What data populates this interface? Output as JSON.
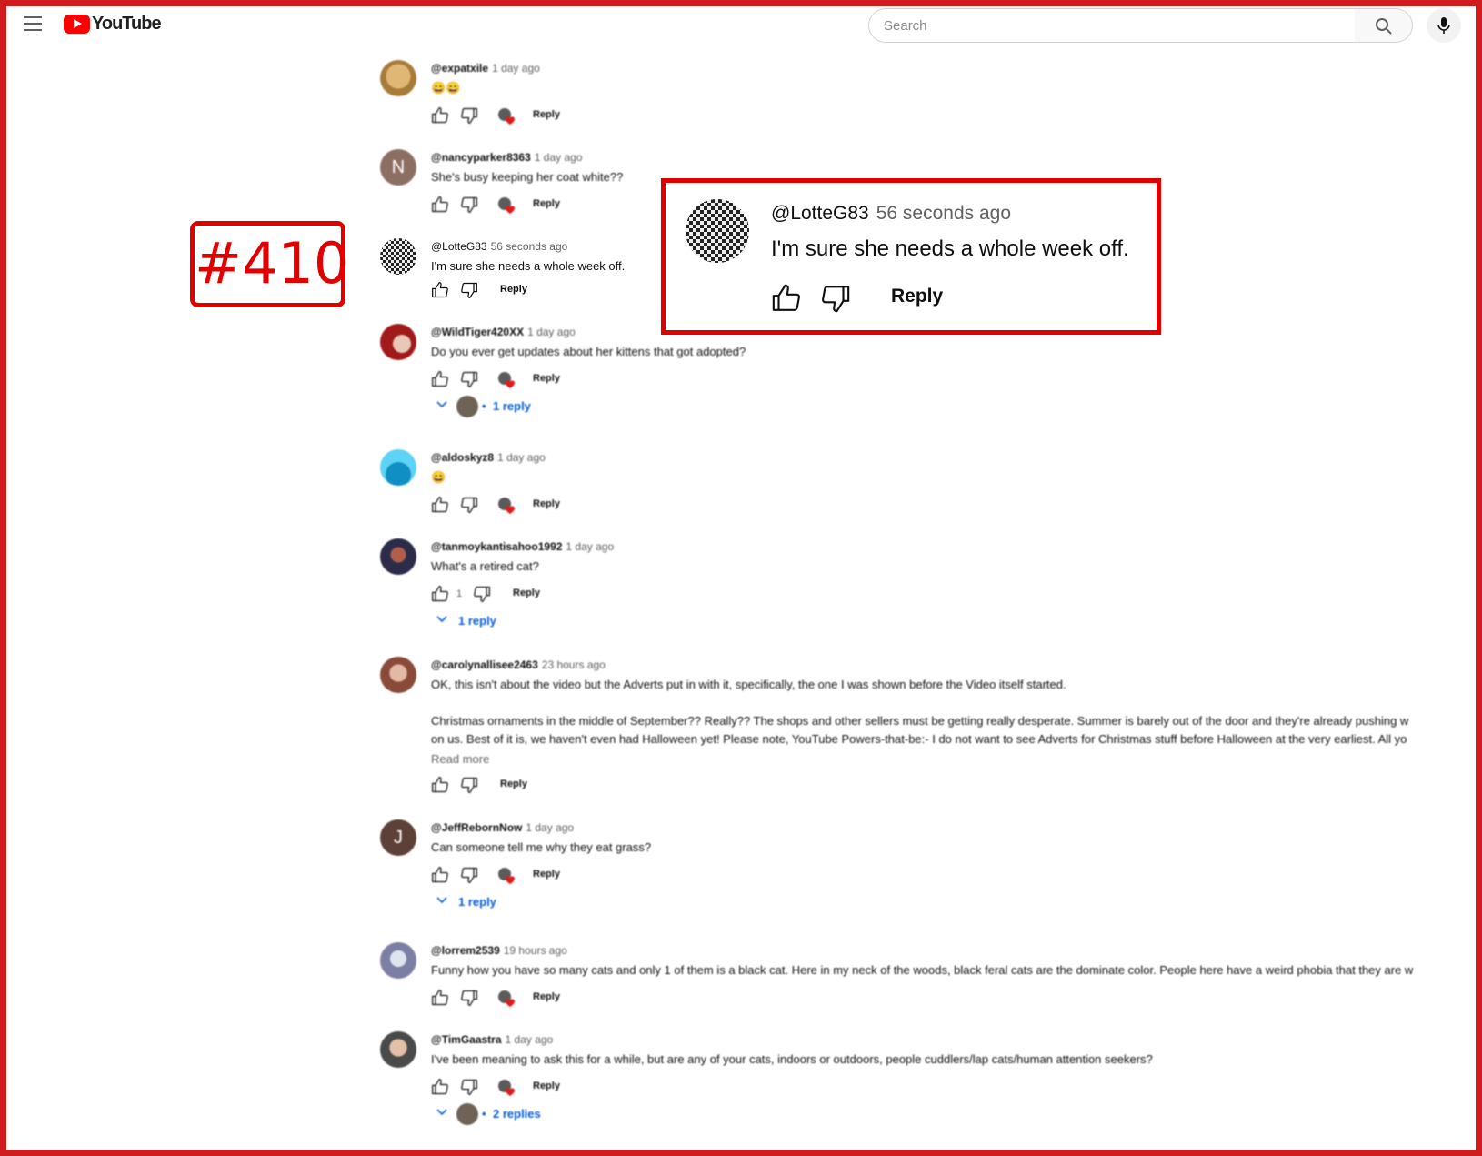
{
  "app": {
    "logo_text": "YouTube",
    "brand_color": "#ff0000",
    "search_placeholder": "Search"
  },
  "annotation": {
    "label": "#410",
    "color": "#e00000"
  },
  "callout": {
    "author": "@LotteG83",
    "time": "56 seconds ago",
    "text": "I'm sure she needs a whole week off.",
    "reply_label": "Reply"
  },
  "comments": [
    {
      "author": "@expatxile",
      "time": "1 day ago",
      "text": "😄😄",
      "reply_label": "Reply",
      "creator_heart": true
    },
    {
      "author": "@nancyparker8363",
      "time": "1 day ago",
      "text": "She's busy keeping her coat white??",
      "reply_label": "Reply",
      "creator_heart": true,
      "avatar_letter": "N",
      "avatar_color": "#8d6e63"
    },
    {
      "author": "@LotteG83",
      "time": "56 seconds ago",
      "text": "I'm sure she needs a whole week off.",
      "reply_label": "Reply",
      "creator_heart": false
    },
    {
      "author": "@WildTiger420XX",
      "time": "1 day ago",
      "text": "Do you ever get updates about her kittens that got adopted?",
      "reply_label": "Reply",
      "creator_heart": true,
      "replies": "1 reply"
    },
    {
      "author": "@aldoskyz8",
      "time": "1 day ago",
      "text": "😄",
      "reply_label": "Reply",
      "creator_heart": true
    },
    {
      "author": "@tanmoykantisahoo1992",
      "time": "1 day ago",
      "text": "What's a retired cat?",
      "reply_label": "Reply",
      "creator_heart": false,
      "like_count": "1",
      "replies": "1 reply"
    },
    {
      "author": "@carolynallisee2463",
      "time": "23 hours ago",
      "text": "OK, this isn't about the video but the Adverts put in with it, specifically, the one I was shown before the Video itself started.",
      "text2": "Christmas ornaments in the middle of September?? Really??  The shops and other sellers must be getting really desperate. Summer is barely out of the door and they're already pushing w",
      "text3": "on us. Best of it is, we haven't even had Halloween yet! Please note, YouTube Powers-that-be:- I do not want to see Adverts for Christmas stuff before Halloween at the very earliest. All yo",
      "read_more": "Read more",
      "reply_label": "Reply",
      "creator_heart": false
    },
    {
      "author": "@JeffRebornNow",
      "time": "1 day ago",
      "text": "Can someone tell me why they eat grass?",
      "reply_label": "Reply",
      "creator_heart": true,
      "avatar_letter": "J",
      "avatar_color": "#5d4037",
      "replies": "1 reply"
    },
    {
      "author": "@lorrem2539",
      "time": "19 hours ago",
      "text": "Funny how you have so many cats and only 1 of them is a black cat. Here in my neck of the woods, black feral cats are the dominate color. People here have a weird phobia that they are w",
      "reply_label": "Reply",
      "creator_heart": true
    },
    {
      "author": "@TimGaastra",
      "time": "1 day ago",
      "text": "I've been meaning to ask this for a while, but are any of your cats, indoors or outdoors, people cuddlers/lap cats/human attention seekers?",
      "reply_label": "Reply",
      "creator_heart": true,
      "replies": "2 replies"
    }
  ]
}
